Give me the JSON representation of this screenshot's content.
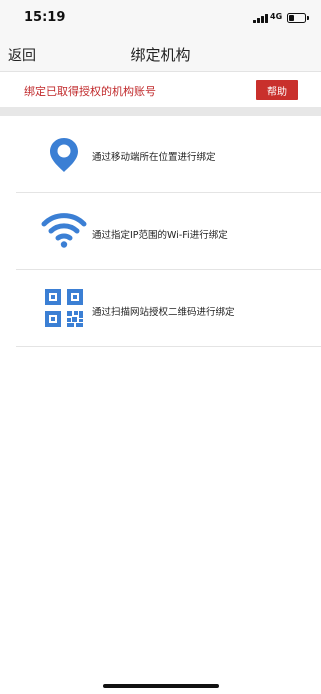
{
  "status_bar": {
    "time": "15:19",
    "network": "4G",
    "battery_level": 0.35
  },
  "nav": {
    "back_label": "返回",
    "title": "绑定机构"
  },
  "notice": {
    "text": "绑定已取得授权的机构账号",
    "help_label": "帮助"
  },
  "options": [
    {
      "icon": "location-pin-icon",
      "label": "通过移动端所在位置进行绑定"
    },
    {
      "icon": "wifi-icon",
      "label": "通过指定IP范围的Wi-Fi进行绑定"
    },
    {
      "icon": "qr-code-icon",
      "label": "通过扫描网站授权二维码进行绑定"
    }
  ],
  "colors": {
    "accent_blue": "#3b7fd4",
    "alert_red": "#c0292b",
    "help_button": "#c9302c"
  }
}
